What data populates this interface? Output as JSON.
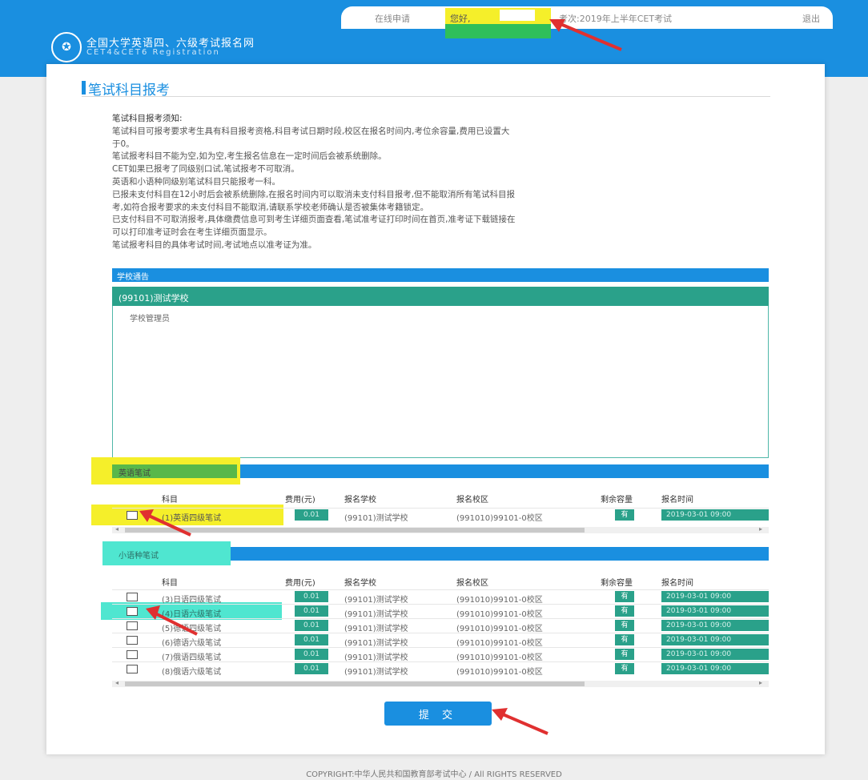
{
  "topbar": {
    "online_users": "在线申请",
    "user_label": "您好,",
    "exam_label": "考次:2019年上半年CET考试",
    "logout": "退出"
  },
  "brand": {
    "title_cn": "全国大学英语四、六级考试报名网",
    "title_en": "CET4&CET6 Registration"
  },
  "page": {
    "title": "笔试科目报考",
    "notes": [
      "笔试科目报考须知:",
      "笔试科目可报考要求考生具有科目报考资格,科目考试日期时段,校区在报名时间内,考位余容量,费用已设置大",
      "于0。",
      "笔试报考科目不能为空,如为空,考生报名信息在一定时间后会被系统删除。",
      "CET如果已报考了同级别口试,笔试报考不可取消。",
      "英语和小语种同级别笔试科目只能报考一科。",
      "已报未支付科目在12小时后会被系统删除,在报名时间内可以取消未支付科目报考,但不能取消所有笔试科目报",
      "考,如符合报考要求的未支付科目不能取消,请联系学校老师确认是否被集体考籍锁定。",
      "已支付科目不可取消报考,具体缴费信息可到考生详细页面查看,笔试准考证打印时间在首页,准考证下载链接在",
      "可以打印准考证时会在考生详细页面显示。",
      "笔试报考科目的具体考试时间,考试地点以准考证为准。"
    ]
  },
  "school_section": {
    "bar_label": "学校通告",
    "school_name": "(99101)测试学校",
    "school_sub": "学校管理员"
  },
  "english_section": {
    "bar_label": "英语笔试",
    "headers": [
      "科目",
      "费用(元)",
      "报名学校",
      "报名校区",
      "剩余容量",
      "报名时间"
    ],
    "rows": [
      {
        "subject": "(1)英语四级笔试",
        "fee": "0.01",
        "school": "(99101)测试学校",
        "campus": "(991010)99101-0校区",
        "capacity": "有",
        "time": "2019-03-01 09:00"
      }
    ]
  },
  "minor_section": {
    "bar_label": "小语种笔试",
    "headers": [
      "科目",
      "费用(元)",
      "报名学校",
      "报名校区",
      "剩余容量",
      "报名时间"
    ],
    "rows": [
      {
        "subject": "(3)日语四级笔试",
        "fee": "0.01",
        "school": "(99101)测试学校",
        "campus": "(991010)99101-0校区",
        "capacity": "有",
        "time": "2019-03-01 09:00"
      },
      {
        "subject": "(4)日语六级笔试",
        "fee": "0.01",
        "school": "(99101)测试学校",
        "campus": "(991010)99101-0校区",
        "capacity": "有",
        "time": "2019-03-01 09:00"
      },
      {
        "subject": "(5)德语四级笔试",
        "fee": "0.01",
        "school": "(99101)测试学校",
        "campus": "(991010)99101-0校区",
        "capacity": "有",
        "time": "2019-03-01 09:00"
      },
      {
        "subject": "(6)德语六级笔试",
        "fee": "0.01",
        "school": "(99101)测试学校",
        "campus": "(991010)99101-0校区",
        "capacity": "有",
        "time": "2019-03-01 09:00"
      },
      {
        "subject": "(7)俄语四级笔试",
        "fee": "0.01",
        "school": "(99101)测试学校",
        "campus": "(991010)99101-0校区",
        "capacity": "有",
        "time": "2019-03-01 09:00"
      },
      {
        "subject": "(8)俄语六级笔试",
        "fee": "0.01",
        "school": "(99101)测试学校",
        "campus": "(991010)99101-0校区",
        "capacity": "有",
        "time": "2019-03-01 09:00"
      }
    ]
  },
  "submit_label": "提 交",
  "footer": {
    "copyright": "COPYRIGHT:中华人民共和国教育部考试中心 / All RIGHTS RESERVED"
  },
  "colors": {
    "primary_blue": "#1a8fe0",
    "teal": "#2aa18a",
    "highlight_yellow": "#f5ef2a",
    "highlight_green": "#2fbf5a",
    "highlight_cyan": "#4fe6d0",
    "arrow_red": "#e03030"
  }
}
